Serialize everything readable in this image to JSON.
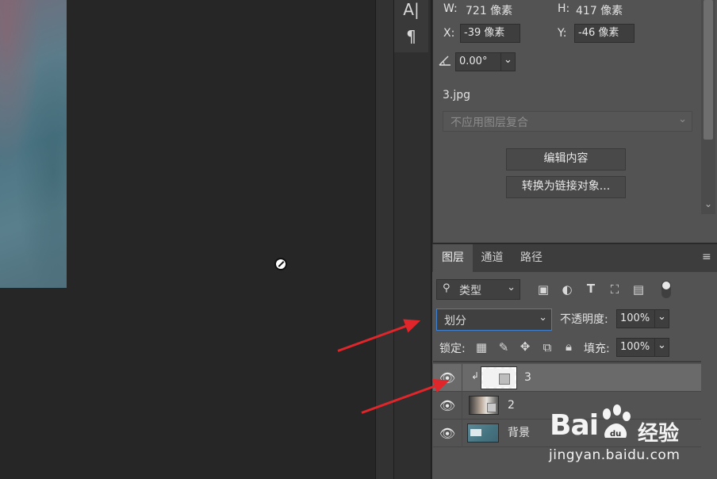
{
  "properties": {
    "w_label": "W:",
    "w_value": "721 像素",
    "h_label": "H:",
    "h_value": "417 像素",
    "x_label": "X:",
    "x_value": "-39 像素",
    "y_label": "Y:",
    "y_value": "-46 像素",
    "angle_value": "0.00°",
    "file_name": "3.jpg",
    "layer_comp_placeholder": "不应用图层复合",
    "edit_contents_label": "编辑内容",
    "convert_linked_label": "转换为链接对象..."
  },
  "layers_panel": {
    "tabs": [
      {
        "label": "图层",
        "active": true
      },
      {
        "label": "通道",
        "active": false
      },
      {
        "label": "路径",
        "active": false
      }
    ],
    "filter_kind_label": "类型",
    "blend_mode": "划分",
    "opacity_label": "不透明度:",
    "opacity_value": "100%",
    "lock_label": "锁定:",
    "fill_label": "填充:",
    "fill_value": "100%",
    "layers": [
      {
        "name": "3",
        "selected": true,
        "clipped": true
      },
      {
        "name": "2",
        "selected": false,
        "clipped": false
      },
      {
        "name": "背景",
        "selected": false,
        "clipped": false
      }
    ]
  },
  "tools": [
    "A|",
    "¶"
  ],
  "watermark": {
    "brand_prefix": "Bai",
    "brand_suffix": "经验",
    "url": "jingyan.baidu.com"
  },
  "colors": {
    "panel_bg": "#535353",
    "canvas_bg": "#262626",
    "annotation_arrow": "#e0262a",
    "selected_layer_bg": "#6a6a6a"
  }
}
